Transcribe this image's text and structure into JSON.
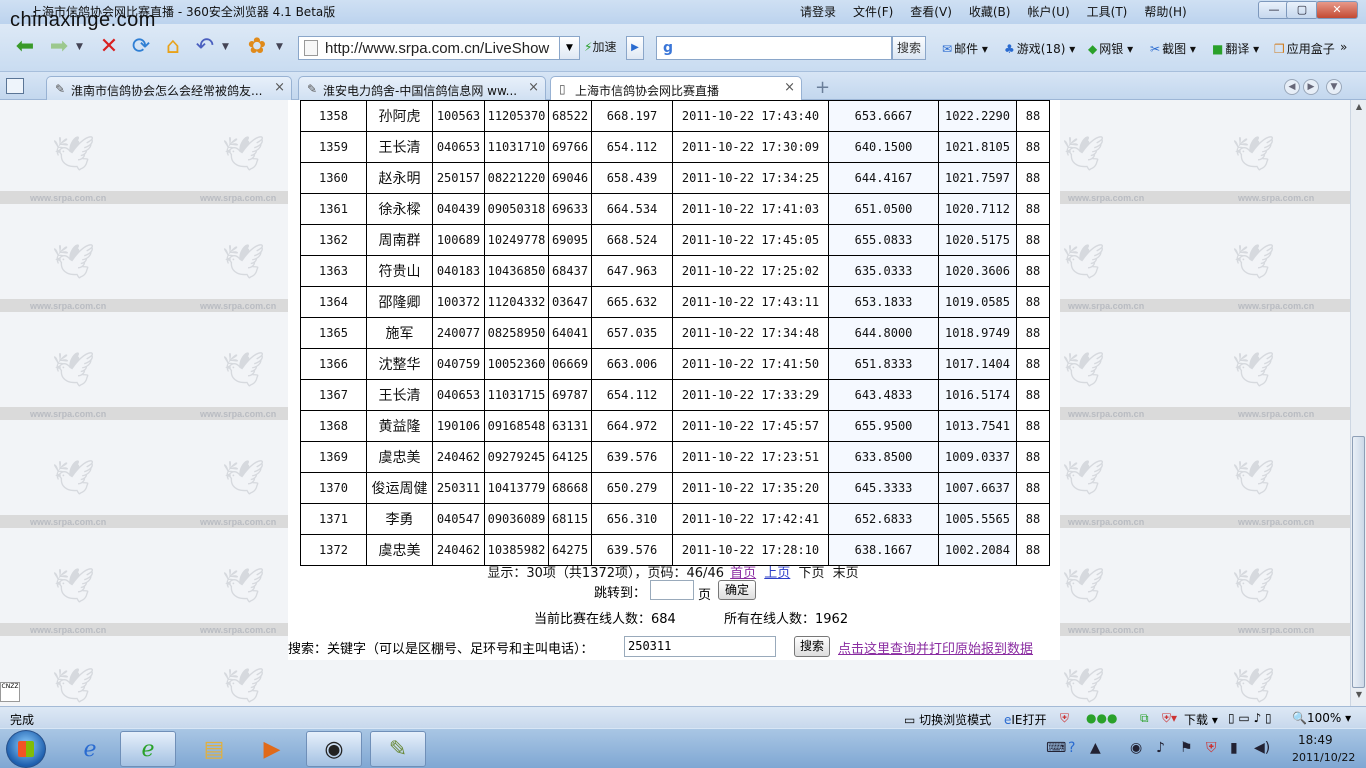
{
  "window": {
    "watermark": "chinaxinge.com",
    "title": "上海市信鸽协会网比赛直播 - 360安全浏览器 4.1 Beta版",
    "menu": [
      "请登录",
      "文件(F)",
      "查看(V)",
      "收藏(B)",
      "帐户(U)",
      "工具(T)",
      "帮助(H)"
    ],
    "controls": [
      "—",
      "▢",
      "✕"
    ]
  },
  "navbar": {
    "address": "http://www.srpa.com.cn/LiveShow",
    "speedup": "加速",
    "search_button": "搜索",
    "tools": [
      "邮件",
      "游戏(18)",
      "网银",
      "截图",
      "翻译",
      "应用盒子"
    ]
  },
  "tabs": [
    {
      "label": "淮南市信鸽协会怎么会经常被鸽友...",
      "active": false
    },
    {
      "label": "淮安电力鸽舍-中国信鸽信息网 ww...",
      "active": false
    },
    {
      "label": "上海市信鸽协会网比赛直播",
      "active": true
    }
  ],
  "page": {
    "watermark_text": "www.srpa.com.cn",
    "rows": [
      [
        "1358",
        "孙阿虎",
        "100563",
        "11205370",
        "68522",
        "668.197",
        "2011-10-22 17:43:40",
        "653.6667",
        "1022.2290",
        "88"
      ],
      [
        "1359",
        "王长清",
        "040653",
        "11031710",
        "69766",
        "654.112",
        "2011-10-22 17:30:09",
        "640.1500",
        "1021.8105",
        "88"
      ],
      [
        "1360",
        "赵永明",
        "250157",
        "08221220",
        "69046",
        "658.439",
        "2011-10-22 17:34:25",
        "644.4167",
        "1021.7597",
        "88"
      ],
      [
        "1361",
        "徐永樑",
        "040439",
        "09050318",
        "69633",
        "664.534",
        "2011-10-22 17:41:03",
        "651.0500",
        "1020.7112",
        "88"
      ],
      [
        "1362",
        "周南群",
        "100689",
        "10249778",
        "69095",
        "668.524",
        "2011-10-22 17:45:05",
        "655.0833",
        "1020.5175",
        "88"
      ],
      [
        "1363",
        "符贵山",
        "040183",
        "10436850",
        "68437",
        "647.963",
        "2011-10-22 17:25:02",
        "635.0333",
        "1020.3606",
        "88"
      ],
      [
        "1364",
        "邵隆卿",
        "100372",
        "11204332",
        "03647",
        "665.632",
        "2011-10-22 17:43:11",
        "653.1833",
        "1019.0585",
        "88"
      ],
      [
        "1365",
        "施军",
        "240077",
        "08258950",
        "64041",
        "657.035",
        "2011-10-22 17:34:48",
        "644.8000",
        "1018.9749",
        "88"
      ],
      [
        "1366",
        "沈整华",
        "040759",
        "10052360",
        "06669",
        "663.006",
        "2011-10-22 17:41:50",
        "651.8333",
        "1017.1404",
        "88"
      ],
      [
        "1367",
        "王长清",
        "040653",
        "11031715",
        "69787",
        "654.112",
        "2011-10-22 17:33:29",
        "643.4833",
        "1016.5174",
        "88"
      ],
      [
        "1368",
        "黄益隆",
        "190106",
        "09168548",
        "63131",
        "664.972",
        "2011-10-22 17:45:57",
        "655.9500",
        "1013.7541",
        "88"
      ],
      [
        "1369",
        "虞忠美",
        "240462",
        "09279245",
        "64125",
        "639.576",
        "2011-10-22 17:23:51",
        "633.8500",
        "1009.0337",
        "88"
      ],
      [
        "1370",
        "俊运周健",
        "250311",
        "10413779",
        "68668",
        "650.279",
        "2011-10-22 17:35:20",
        "645.3333",
        "1007.6637",
        "88"
      ],
      [
        "1371",
        "李勇",
        "040547",
        "09036089",
        "68115",
        "656.310",
        "2011-10-22 17:42:41",
        "652.6833",
        "1005.5565",
        "88"
      ],
      [
        "1372",
        "虞忠美",
        "240462",
        "10385982",
        "64275",
        "639.576",
        "2011-10-22 17:28:10",
        "638.1667",
        "1002.2084",
        "88"
      ]
    ],
    "pager": {
      "summary": "显示：30项（共1372项），页码：46/46",
      "first": "首页",
      "prev": "上页",
      "next": "下页",
      "last": "末页",
      "jump_label": "跳转到：",
      "jump_unit": "页",
      "jump_ok": "确定"
    },
    "online_race": "当前比赛在线人数：684",
    "online_all": "所有在线人数：1962",
    "search": {
      "label": "搜索：关键字（可以是区棚号、足环号和主叫电话）：",
      "value": "250311",
      "button": "搜索",
      "print_link": "点击这里查询并打印原始报到数据"
    },
    "cnzz": "CNZZ"
  },
  "statusbar": {
    "text": "完成",
    "items": [
      "切换浏览模式",
      "IE打开",
      "下载",
      "100%"
    ]
  },
  "taskbar": {
    "time": "18:49",
    "date": "2011/10/22"
  }
}
